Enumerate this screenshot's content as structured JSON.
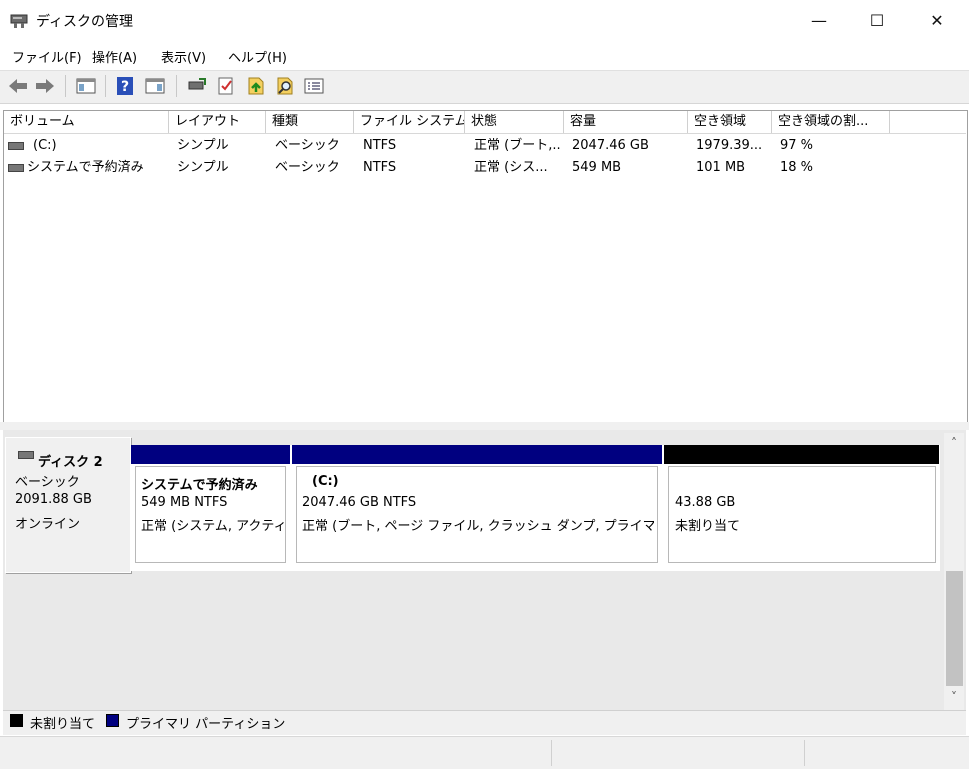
{
  "window": {
    "title": "ディスクの管理",
    "minimize_glyph": "—",
    "maximize_glyph": "☐",
    "close_glyph": "✕"
  },
  "menu": [
    "ファイル(F)",
    "操作(A)",
    "表示(V)",
    "ヘルプ(H)"
  ],
  "toolbar": {
    "icons": [
      "back-arrow-icon",
      "forward-arrow-icon",
      "show-hide-console-tree-icon",
      "help-icon",
      "console-tree-icon",
      "connect-drive-icon",
      "checklist-properties-icon",
      "rescan-disks-icon",
      "search-icon",
      "list-view-icon"
    ]
  },
  "volume_table": {
    "columns": [
      "ボリューム",
      "レイアウト",
      "種類",
      "ファイル システム",
      "状態",
      "容量",
      "空き領域",
      "空き領域の割..."
    ],
    "rows": [
      [
        "(C:)",
        "シンプル",
        "ベーシック",
        "NTFS",
        "正常 (ブート,...",
        "2047.46 GB",
        "1979.39...",
        "97 %"
      ],
      [
        "システムで予約済み",
        "シンプル",
        "ベーシック",
        "NTFS",
        "正常 (シス...",
        "549 MB",
        "101 MB",
        "18 %"
      ]
    ]
  },
  "disk": {
    "name": "ディスク 2",
    "type": "ベーシック",
    "size": "2091.88 GB",
    "status": "オンライン"
  },
  "partitions": [
    {
      "name": "システムで予約済み",
      "size": "549 MB NTFS",
      "status": "正常 (システム, アクティブ, プライマリ パーティション)",
      "bar_color": "#000080"
    },
    {
      "name": "(C:)",
      "size": "2047.46 GB NTFS",
      "status": "正常 (ブート, ページ ファイル, クラッシュ ダンプ, プライマリ パーティション)",
      "bar_color": "#000080"
    },
    {
      "name": "",
      "size": "43.88 GB",
      "status": "未割り当て",
      "bar_color": "#000000"
    }
  ],
  "legend": [
    {
      "label": "未割り当て",
      "color": "#000000"
    },
    {
      "label": "プライマリ パーティション",
      "color": "#000080"
    }
  ],
  "scroll": {
    "up_glyph": "˄",
    "down_glyph": "˅"
  }
}
